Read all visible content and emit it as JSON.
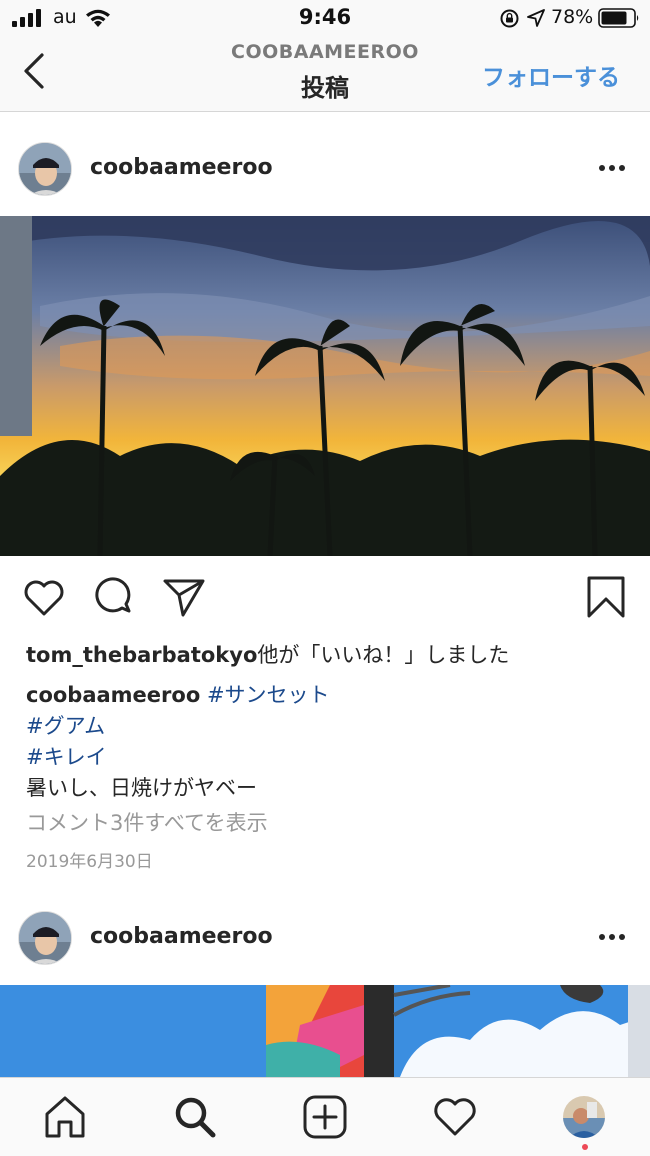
{
  "status_bar": {
    "carrier": "au",
    "time": "9:46",
    "battery": "78%"
  },
  "nav": {
    "account": "COOBAAMEEROO",
    "title": "投稿",
    "follow_label": "フォローする"
  },
  "posts": [
    {
      "username": "coobaameeroo",
      "liked_by_user": "tom_thebarbatokyo",
      "liked_by_suffix": "他が「いいね！」しました",
      "caption_user": "coobaameeroo",
      "hashtags": [
        "#サンセット",
        "#グアム",
        "#キレイ"
      ],
      "caption_text": "暑いし、日焼けがヤベー",
      "comments_link": "コメント3件すべてを表示",
      "date": "2019年6月30日"
    },
    {
      "username": "coobaameeroo"
    }
  ],
  "tabbar": {
    "items": [
      "home-icon",
      "search-icon",
      "new-post-icon",
      "activity-heart-icon",
      "profile-avatar"
    ]
  },
  "colors": {
    "link_blue": "#4a90d9",
    "hashtag_blue": "#1c4a8c",
    "notification_dot": "#ed4956"
  }
}
